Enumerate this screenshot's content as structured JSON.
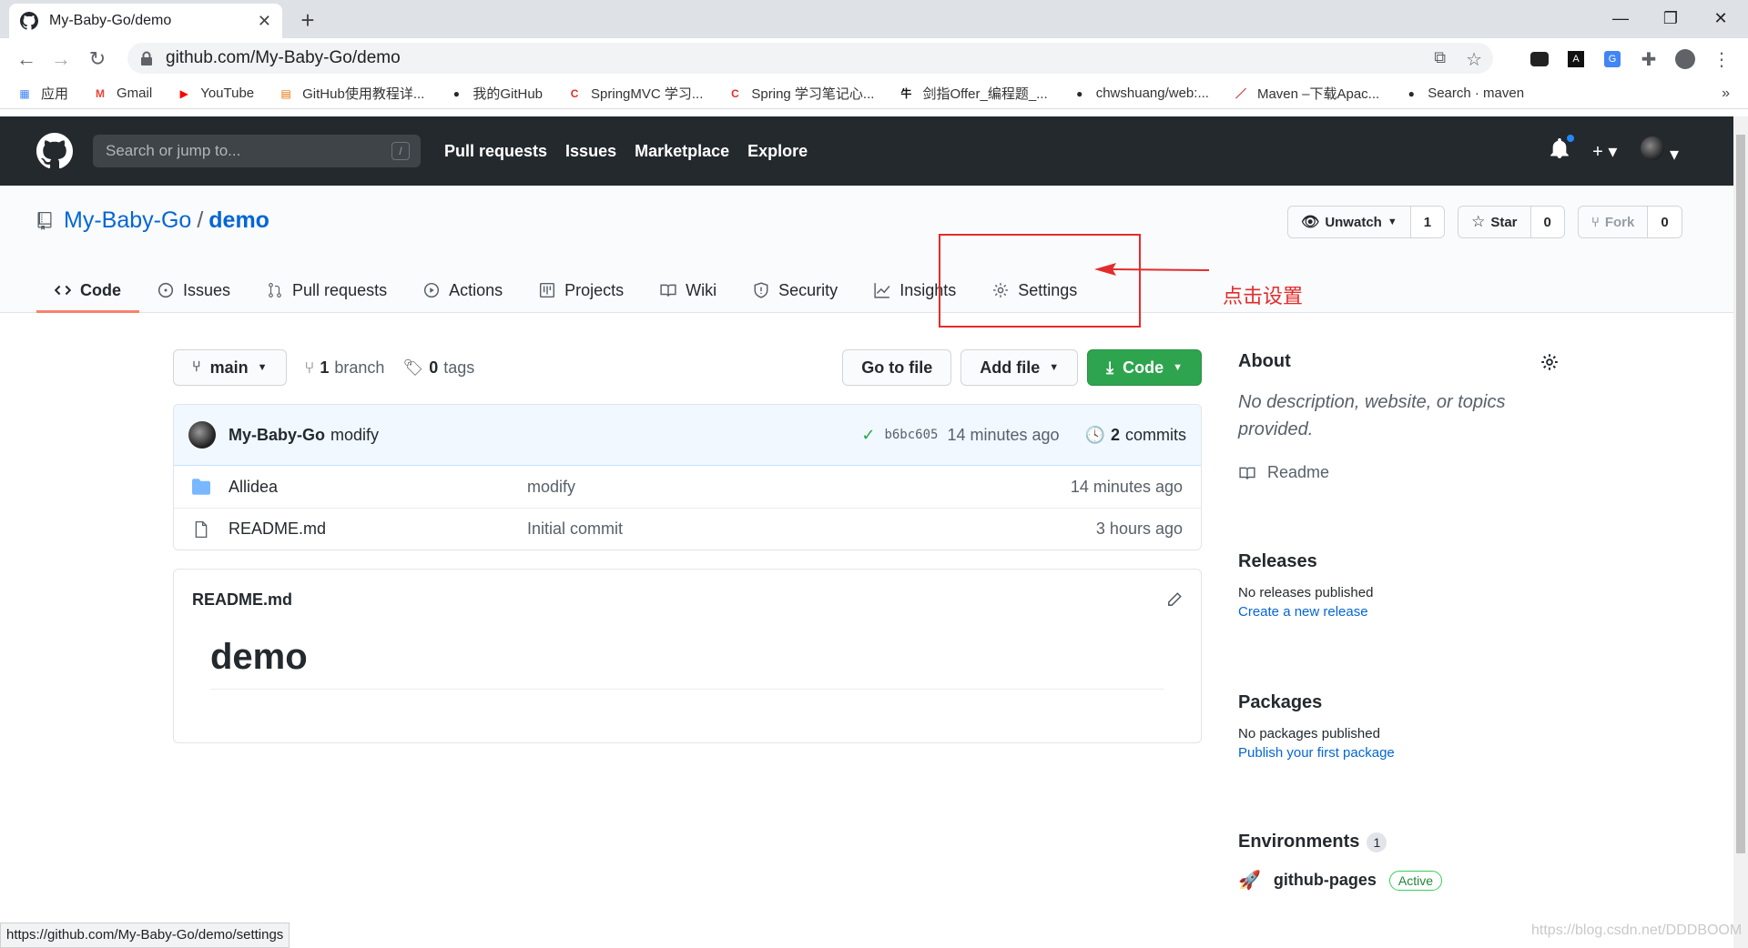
{
  "browser": {
    "tab_title": "My-Baby-Go/demo",
    "url": "github.com/My-Baby-Go/demo",
    "status_url": "https://github.com/My-Baby-Go/demo/settings"
  },
  "bookmarks": [
    {
      "label": "应用",
      "icon": "apps-grid-icon",
      "color": "#4285f4"
    },
    {
      "label": "Gmail",
      "icon": "gmail-icon",
      "color": "#ea4335"
    },
    {
      "label": "YouTube",
      "icon": "youtube-icon",
      "color": "#ff0000"
    },
    {
      "label": "GitHub使用教程详...",
      "icon": "doc-icon",
      "color": "#e8710a"
    },
    {
      "label": "我的GitHub",
      "icon": "github-icon",
      "color": "#24292e"
    },
    {
      "label": "SpringMVC 学习...",
      "icon": "csdn-icon",
      "color": "#e32c2c"
    },
    {
      "label": "Spring 学习笔记心...",
      "icon": "csdn-icon",
      "color": "#e32c2c"
    },
    {
      "label": "剑指Offer_编程题_...",
      "icon": "nowcoder-icon",
      "color": "#111111"
    },
    {
      "label": "chwshuang/web:...",
      "icon": "github-icon",
      "color": "#24292e"
    },
    {
      "label": "Maven –下载Apac...",
      "icon": "feather-icon",
      "color": "#d22128"
    },
    {
      "label": "Search · maven",
      "icon": "github-icon",
      "color": "#24292e"
    }
  ],
  "github": {
    "search_placeholder": "Search or jump to...",
    "search_key": "/",
    "nav": [
      "Pull requests",
      "Issues",
      "Marketplace",
      "Explore"
    ]
  },
  "repo": {
    "owner": "My-Baby-Go",
    "name": "demo",
    "separator": "/",
    "watch_label": "Unwatch",
    "watch_count": "1",
    "star_label": "Star",
    "star_count": "0",
    "fork_label": "Fork",
    "fork_count": "0",
    "tabs": [
      {
        "label": "Code",
        "icon": "code-icon"
      },
      {
        "label": "Issues",
        "icon": "issue-icon"
      },
      {
        "label": "Pull requests",
        "icon": "pull-request-icon"
      },
      {
        "label": "Actions",
        "icon": "play-icon"
      },
      {
        "label": "Projects",
        "icon": "project-icon"
      },
      {
        "label": "Wiki",
        "icon": "book-icon"
      },
      {
        "label": "Security",
        "icon": "shield-icon"
      },
      {
        "label": "Insights",
        "icon": "graph-icon"
      },
      {
        "label": "Settings",
        "icon": "gear-icon"
      }
    ]
  },
  "annotation": {
    "text": "点击设置",
    "color": "#e32c2c"
  },
  "branch_bar": {
    "branch": "main",
    "branch_count": "1",
    "branch_word": "branch",
    "tag_count": "0",
    "tag_word": "tags",
    "goto_file": "Go to file",
    "add_file": "Add file",
    "code": "Code"
  },
  "commit": {
    "author": "My-Baby-Go",
    "message": "modify",
    "sha": "b6bc605",
    "age": "14 minutes ago",
    "count": "2",
    "count_word": "commits"
  },
  "files": [
    {
      "name": "Allidea",
      "type": "folder",
      "message": "modify",
      "age": "14 minutes ago"
    },
    {
      "name": "README.md",
      "type": "file",
      "message": "Initial commit",
      "age": "3 hours ago"
    }
  ],
  "readme": {
    "filename": "README.md",
    "heading": "demo"
  },
  "sidebar": {
    "about_title": "About",
    "about_desc": "No description, website, or topics provided.",
    "readme_link": "Readme",
    "releases_title": "Releases",
    "releases_none": "No releases published",
    "releases_link": "Create a new release",
    "packages_title": "Packages",
    "packages_none": "No packages published",
    "packages_link": "Publish your first package",
    "env_title": "Environments",
    "env_count": "1",
    "env_name": "github-pages",
    "env_status": "Active"
  },
  "watermark": "https://blog.csdn.net/DDDBOOM"
}
